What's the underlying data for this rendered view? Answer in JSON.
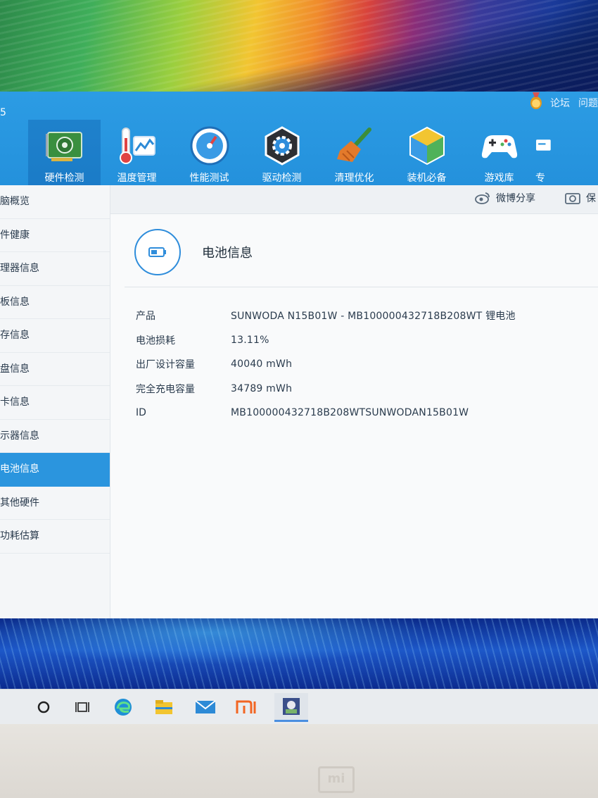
{
  "window": {
    "corner_mark": "5"
  },
  "topbar": {
    "forum": "论坛",
    "help": "问题"
  },
  "nav": [
    {
      "label": "硬件检测",
      "icon": "hardware-card-icon"
    },
    {
      "label": "温度管理",
      "icon": "thermometer-icon"
    },
    {
      "label": "性能测试",
      "icon": "speedometer-icon"
    },
    {
      "label": "驱动检测",
      "icon": "driver-gear-icon"
    },
    {
      "label": "清理优化",
      "icon": "broom-icon"
    },
    {
      "label": "装机必备",
      "icon": "box-icon"
    },
    {
      "label": "游戏库",
      "icon": "gamepad-icon"
    },
    {
      "label": "专",
      "icon": "toolbox-icon"
    }
  ],
  "sidebar": {
    "items": [
      "脑概览",
      "件健康",
      "理器信息",
      "板信息",
      "存信息",
      "盘信息",
      "卡信息",
      "示器信息",
      "电池信息",
      "其他硬件",
      "功耗估算"
    ],
    "active_index": 8
  },
  "share": {
    "weibo": "微博分享",
    "save": "保"
  },
  "section": {
    "title": "电池信息"
  },
  "battery": {
    "rows": [
      {
        "label": "产品",
        "value": "SUNWODA N15B01W - MB100000432718B208WT 锂电池"
      },
      {
        "label": "电池损耗",
        "value": "13.11%"
      },
      {
        "label": "出厂设计容量",
        "value": "40040 mWh"
      },
      {
        "label": "完全充电容量",
        "value": "34789 mWh"
      },
      {
        "label": "ID",
        "value": "MB100000432718B208WTSUNWODAN15B01W"
      }
    ]
  },
  "taskbar": [
    "search-circle-icon",
    "task-view-icon",
    "edge-icon",
    "file-explorer-icon",
    "mail-icon",
    "mi-icon",
    "app-icon"
  ],
  "bezel": {
    "logo": "mi"
  },
  "colors": {
    "accent": "#2b95de",
    "toolbar": "#2491dc"
  }
}
